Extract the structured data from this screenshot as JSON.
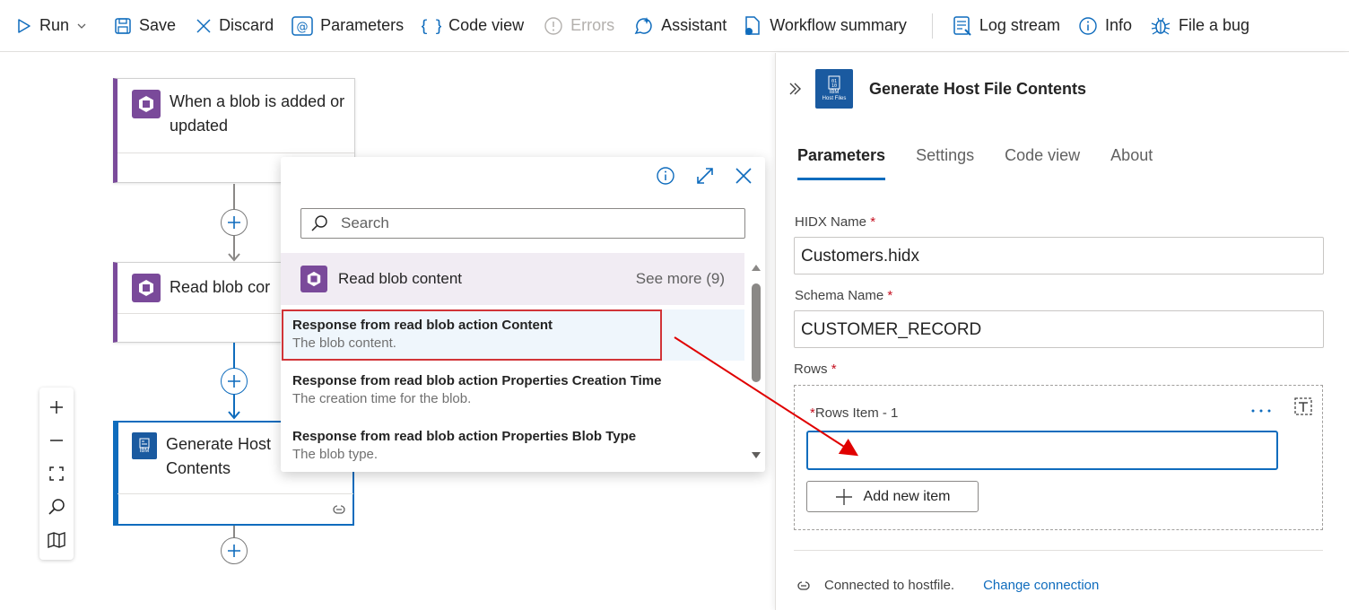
{
  "toolbar": {
    "run": "Run",
    "save": "Save",
    "discard": "Discard",
    "parameters": "Parameters",
    "code_view": "Code view",
    "errors": "Errors",
    "assistant": "Assistant",
    "workflow_summary": "Workflow summary",
    "log_stream": "Log stream",
    "info": "Info",
    "file_bug": "File a bug"
  },
  "canvas": {
    "trigger_title": "When a blob is added or updated",
    "read_title": "Read blob cor",
    "generate_title_line1": "Generate Host",
    "generate_title_line2": "Contents"
  },
  "popup": {
    "search_placeholder": "Search",
    "group_title": "Read blob content",
    "see_more": "See more (9)",
    "items": [
      {
        "title": "Response from read blob action Content",
        "desc": "The blob content."
      },
      {
        "title": "Response from read blob action Properties Creation Time",
        "desc": "The creation time for the blob."
      },
      {
        "title": "Response from read blob action Properties Blob Type",
        "desc": "The blob type."
      }
    ]
  },
  "panel": {
    "title": "Generate Host File Contents",
    "icon_text_top": "01\n10",
    "icon_label1": "IBM",
    "icon_label2": "Host Files",
    "tabs": [
      "Parameters",
      "Settings",
      "Code view",
      "About"
    ],
    "hidx_label": "HIDX Name",
    "hidx_value": "Customers.hidx",
    "schema_label": "Schema Name",
    "schema_value": "CUSTOMER_RECORD",
    "rows_label": "Rows",
    "rows_item_label": "Rows Item - 1",
    "add_new_item": "Add new item",
    "connected_text": "Connected to hostfile.",
    "change_connection": "Change connection",
    "required_mark": "*"
  },
  "colors": {
    "accent": "#0f6cbd",
    "blob_purple": "#7a4a9a",
    "ibm_blue": "#1a5aa0",
    "highlight_red": "#d13438"
  }
}
